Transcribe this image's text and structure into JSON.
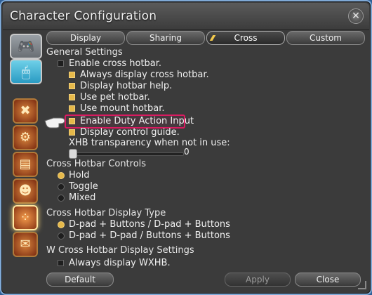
{
  "window": {
    "title": "Character Configuration"
  },
  "tabs": [
    {
      "label": "Display",
      "active": false
    },
    {
      "label": "Sharing",
      "active": false
    },
    {
      "label": "Cross",
      "active": true
    },
    {
      "label": "Custom",
      "active": false
    }
  ],
  "settings": {
    "general_title": "General Settings",
    "enable_cross_hotbar": "Enable cross hotbar.",
    "always_display_cross": "Always display cross hotbar.",
    "display_help": "Display hotbar help.",
    "use_pet": "Use pet hotbar.",
    "use_mount": "Use mount hotbar.",
    "enable_duty": "Enable Duty Action Input",
    "display_control": "Display control guide.",
    "xhb_transparency_label": "XHB transparency when not in use:",
    "xhb_transparency_value": "0",
    "controls_title": "Cross Hotbar Controls",
    "hold": "Hold",
    "toggle": "Toggle",
    "mixed": "Mixed",
    "display_type_title": "Cross Hotbar Display Type",
    "display_type_1": "D-pad + Buttons / D-pad + Buttons",
    "display_type_2": "D-pad + D-pad / Buttons + Buttons",
    "w_title": "W Cross Hotbar Display Settings",
    "always_display_wxhb": "Always display WXHB."
  },
  "footer": {
    "default": "Default",
    "apply": "Apply",
    "close": "Close"
  },
  "icons": [
    "gamepad-icon",
    "mouse-icon",
    "crossed-swords-icon",
    "gear-pouch-icon",
    "card-icon",
    "character-icon",
    "hotbar-icon",
    "chat-icon",
    "pointing-hand-icon"
  ]
}
